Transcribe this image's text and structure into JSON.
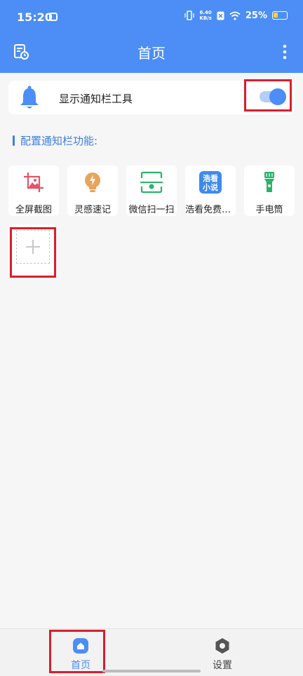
{
  "status_bar": {
    "time": "15:20",
    "net_speed_value": "6.40",
    "net_speed_unit": "KB/s",
    "battery": "25%"
  },
  "header": {
    "title": "首页",
    "left_icon": "history-icon",
    "right_icon": "more-vert-icon"
  },
  "toggle_card": {
    "label": "显示通知栏工具",
    "enabled": true,
    "icon": "bell-icon"
  },
  "section": {
    "title": "配置通知栏功能:"
  },
  "tiles": [
    {
      "label": "全屏截图",
      "icon": "screenshot-icon",
      "color": "#e2546a"
    },
    {
      "label": "灵感速记",
      "icon": "lightbulb-icon",
      "color": "#e9a35a"
    },
    {
      "label": "微信扫一扫",
      "icon": "scan-icon",
      "color": "#2bb36a"
    },
    {
      "label": "浩看免费小说",
      "icon": "novel-app-icon",
      "icon_text_1": "浩看",
      "icon_text_2": "小说",
      "color": "#3d8af0"
    },
    {
      "label": "手电筒",
      "icon": "flashlight-icon",
      "color": "#2bb36a"
    }
  ],
  "add_tile": {
    "icon": "plus-icon"
  },
  "bottom_nav": [
    {
      "label": "首页",
      "icon": "home-icon",
      "active": true
    },
    {
      "label": "设置",
      "icon": "settings-icon",
      "active": false
    }
  ],
  "colors": {
    "primary": "#4c8ef5",
    "highlight_box": "#d81e2c"
  }
}
